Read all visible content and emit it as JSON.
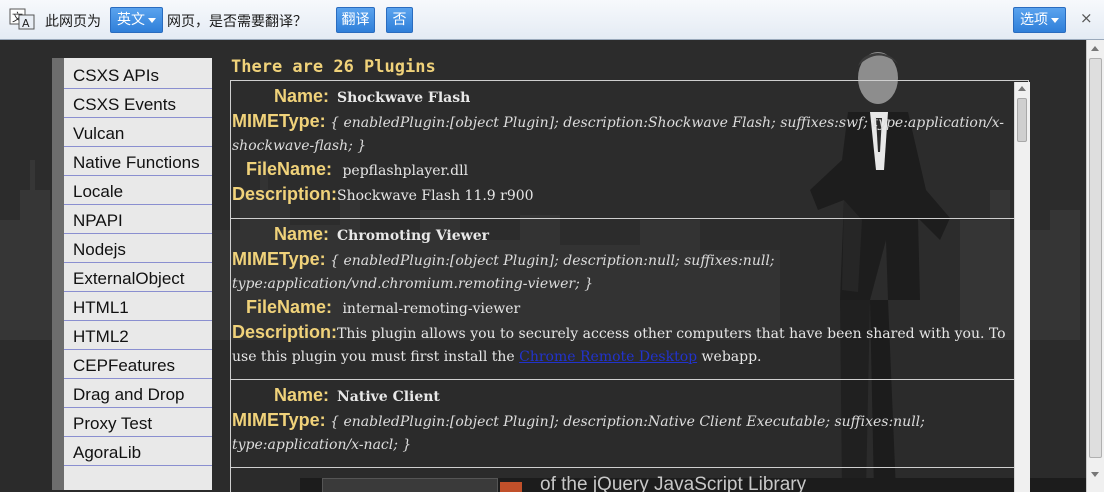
{
  "translate_bar": {
    "prompt_prefix": "此网页为",
    "language_selected": "英文",
    "prompt_suffix": "网页，是否需要翻译？",
    "translate_button": "翻译",
    "no_button": "否",
    "options_button": "选项",
    "close_glyph": "×"
  },
  "sidebar": {
    "items": [
      {
        "label": "CSXS APIs"
      },
      {
        "label": "CSXS Events"
      },
      {
        "label": "Vulcan"
      },
      {
        "label": "Native Functions"
      },
      {
        "label": "Locale"
      },
      {
        "label": "NPAPI"
      },
      {
        "label": "Nodejs"
      },
      {
        "label": "ExternalObject"
      },
      {
        "label": "HTML1"
      },
      {
        "label": "HTML2"
      },
      {
        "label": "CEPFeatures"
      },
      {
        "label": "Drag and Drop"
      },
      {
        "label": "Proxy Test"
      },
      {
        "label": "AgoraLib"
      }
    ]
  },
  "main": {
    "heading": "There are 26 Plugins",
    "labels": {
      "name": "Name:",
      "mimetype": "MIMEType:",
      "filename": "FileName:",
      "description": "Description:"
    },
    "plugins": [
      {
        "name": "Shockwave Flash",
        "mimetype": "{ enabledPlugin:[object Plugin]; description:Shockwave Flash; suffixes:swf; type:application/x-shockwave-flash; }",
        "filename": "pepflashplayer.dll",
        "description": "Shockwave Flash 11.9 r900"
      },
      {
        "name": "Chromoting Viewer",
        "mimetype": "{ enabledPlugin:[object Plugin]; description:null; suffixes:null; type:application/vnd.chromium.remoting-viewer; }",
        "filename": "internal-remoting-viewer",
        "description_pre": "This plugin allows you to securely access other computers that have been shared with you. To use this plugin you must first install the ",
        "description_link": "Chrome Remote Desktop",
        "description_post": " webapp."
      },
      {
        "name": "Native Client",
        "mimetype": "{ enabledPlugin:[object Plugin]; description:Native Client Executable; suffixes:null; type:application/x-nacl; }"
      }
    ]
  },
  "footer": {
    "text": "of the jQuery JavaScript Library"
  },
  "colors": {
    "label_gold": "#f0d27a",
    "link_blue": "#2233cc",
    "bar_button_blue": "#2f7fd9"
  },
  "icons": [
    "translate-icon",
    "dropdown-caret-icon",
    "close-icon",
    "scroll-up-icon",
    "scroll-down-icon"
  ]
}
